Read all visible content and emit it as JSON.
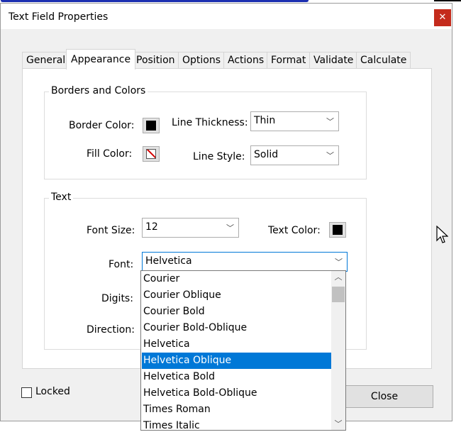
{
  "window": {
    "title": "Text Field Properties",
    "close_glyph": "✕"
  },
  "tabs": [
    {
      "label": "General"
    },
    {
      "label": "Appearance",
      "active": true
    },
    {
      "label": "Position"
    },
    {
      "label": "Options"
    },
    {
      "label": "Actions"
    },
    {
      "label": "Format"
    },
    {
      "label": "Validate"
    },
    {
      "label": "Calculate"
    }
  ],
  "borders": {
    "group_label": "Borders and Colors",
    "border_color_label": "Border Color:",
    "border_color": "#000000",
    "fill_color_label": "Fill Color:",
    "fill_color": "none",
    "line_thickness_label": "Line Thickness:",
    "line_thickness_value": "Thin",
    "line_style_label": "Line Style:",
    "line_style_value": "Solid"
  },
  "text": {
    "group_label": "Text",
    "font_size_label": "Font Size:",
    "font_size_value": "12",
    "text_color_label": "Text Color:",
    "text_color": "#000000",
    "font_label": "Font:",
    "font_value": "Helvetica",
    "digits_label": "Digits:",
    "direction_label": "Direction:"
  },
  "font_options": [
    "Courier",
    "Courier Oblique",
    "Courier Bold",
    "Courier Bold-Oblique",
    "Helvetica",
    "Helvetica Oblique",
    "Helvetica Bold",
    "Helvetica Bold-Oblique",
    "Times Roman",
    "Times Italic"
  ],
  "highlighted_option": "Helvetica Oblique",
  "footer": {
    "locked_label": "Locked",
    "locked_checked": false,
    "close_label": "Close"
  },
  "colors": {
    "accent": "#0078d7",
    "close_red": "#c42b1c"
  }
}
